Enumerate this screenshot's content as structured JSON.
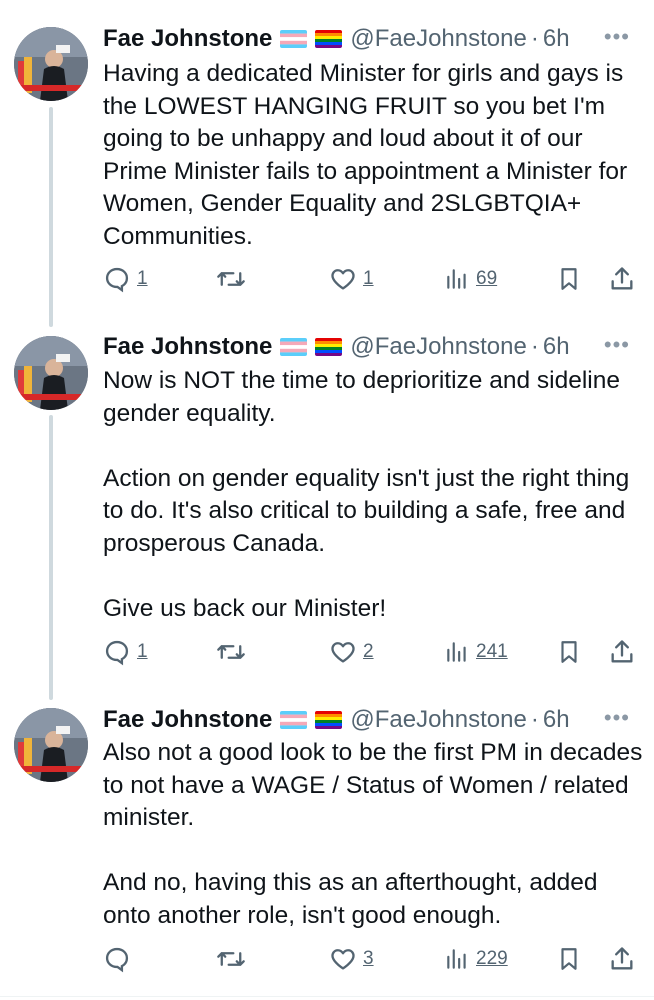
{
  "author": {
    "name": "Fae Johnstone",
    "handle": "@FaeJohnstone",
    "flags": [
      "transgender-flag-icon",
      "rainbow-flag-icon"
    ]
  },
  "colors": {
    "text": "#0f1419",
    "secondary": "#536471",
    "thread_line": "#cfd9de"
  },
  "tweets": [
    {
      "time": "6h",
      "separator": "·",
      "paragraphs": [
        "Having a dedicated Minister for girls and gays is the LOWEST HANGING FRUIT so you bet I'm going to be unhappy and loud about it of our Prime Minister fails to appointment a Minister for Women, Gender Equality and 2SLGBTQIA+ Communities."
      ],
      "replies": "1",
      "retweets": "",
      "likes": "1",
      "views": "69"
    },
    {
      "time": "6h",
      "separator": "·",
      "paragraphs": [
        "Now is NOT the time to deprioritize and sideline gender equality.",
        "Action on gender equality isn't just the right thing to do. It's also critical to building a safe, free and prosperous Canada.",
        "Give us back our Minister!"
      ],
      "replies": "1",
      "retweets": "",
      "likes": "2",
      "views": "241"
    },
    {
      "time": "6h",
      "separator": "·",
      "paragraphs": [
        "Also not a good look to be the first PM in decades to not have a WAGE / Status of Women / related minister.",
        "And no, having this as an afterthought, added onto another role, isn't good enough."
      ],
      "replies": "",
      "retweets": "",
      "likes": "3",
      "views": "229"
    }
  ]
}
